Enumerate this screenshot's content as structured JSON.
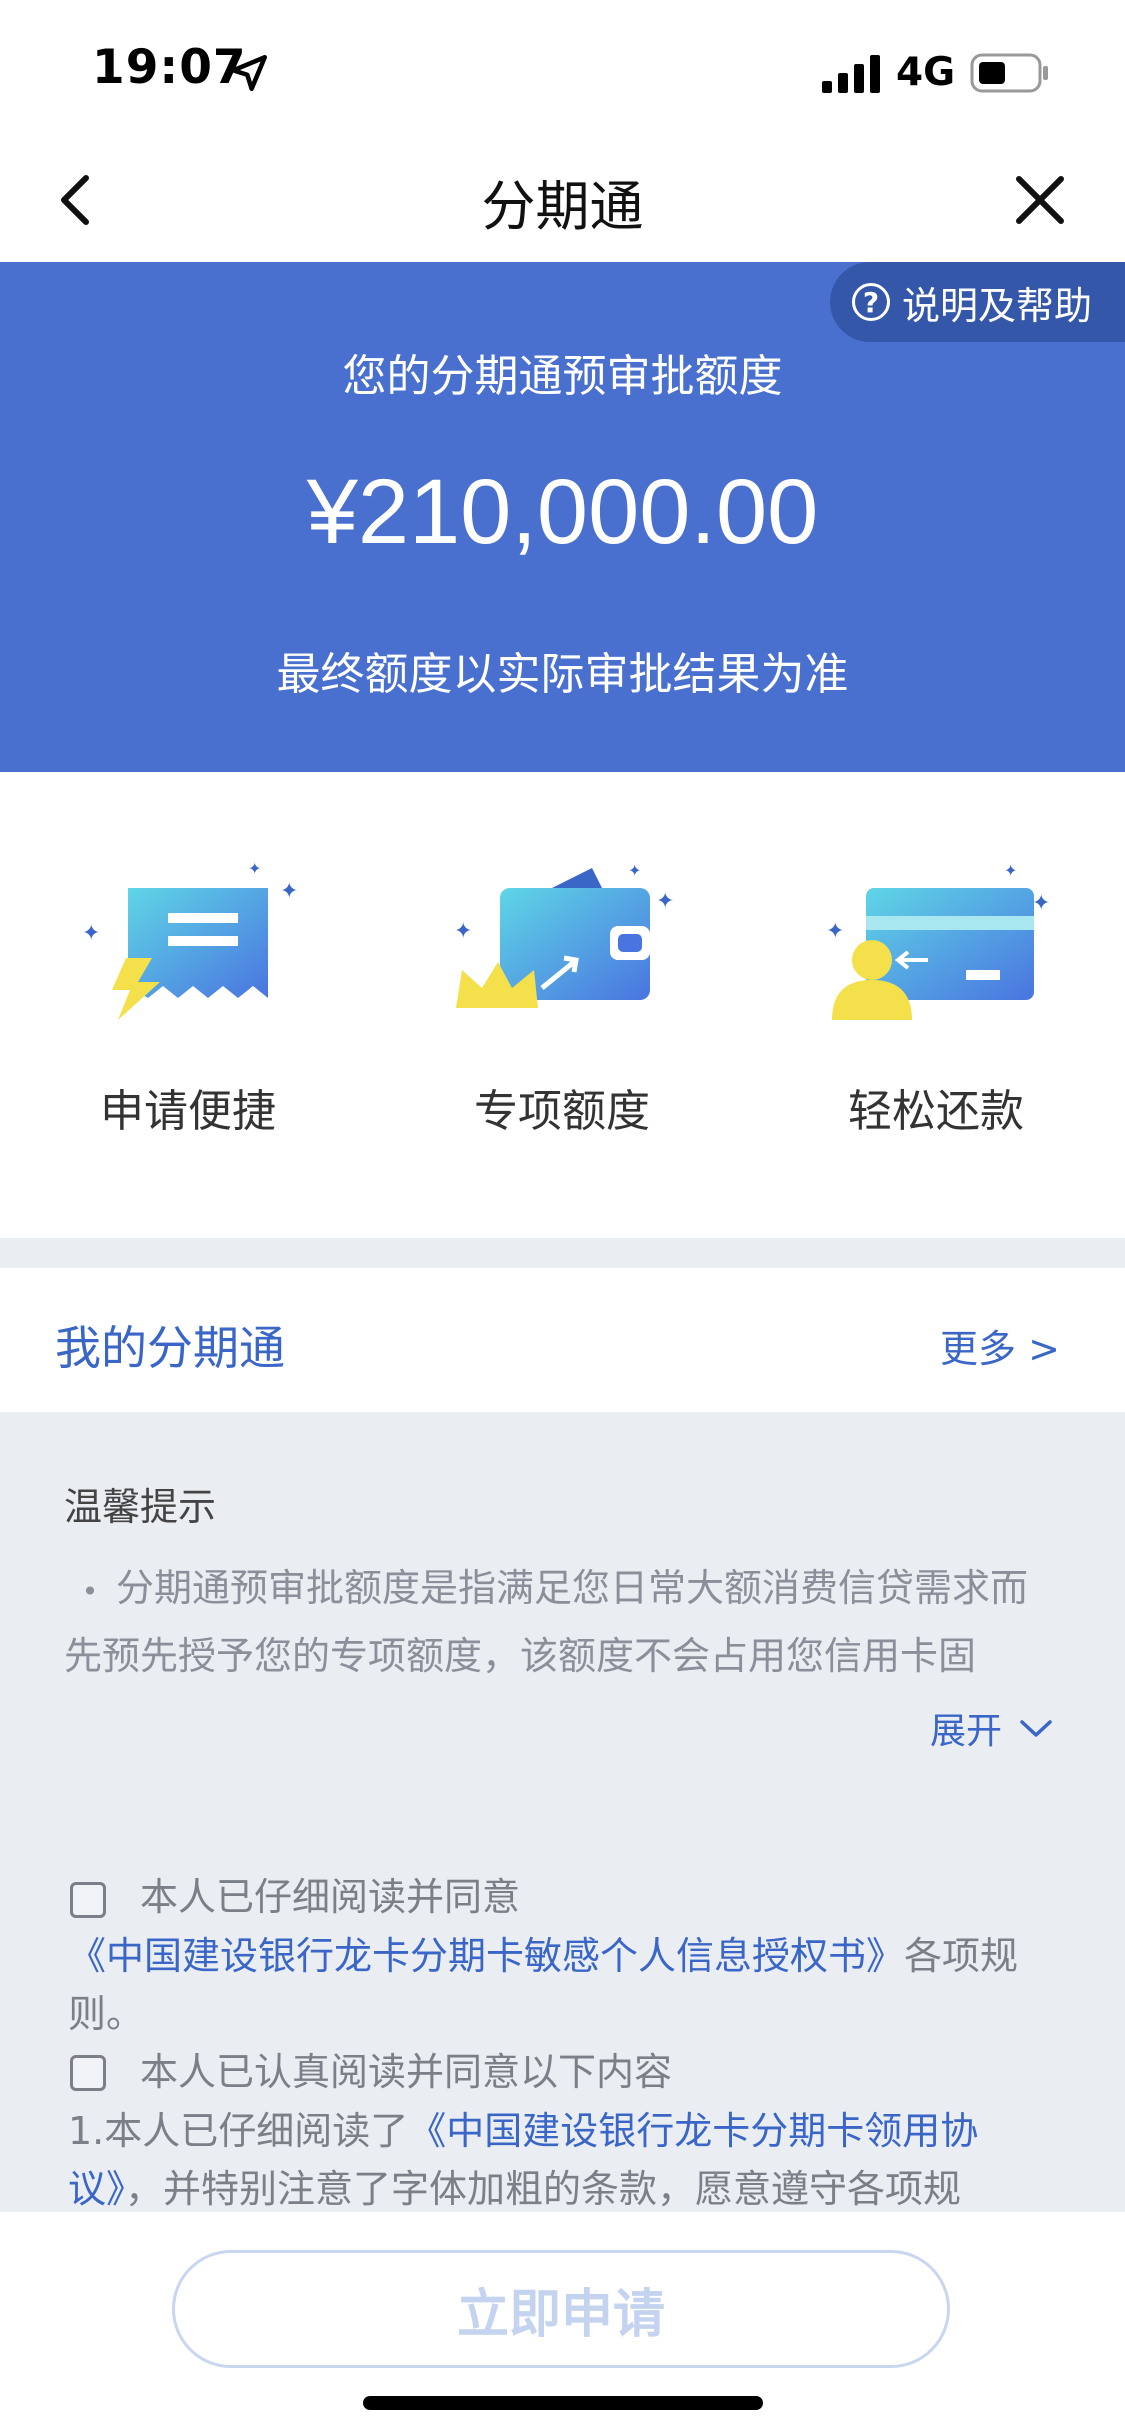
{
  "status_bar": {
    "time": "19:07",
    "network": "4G"
  },
  "nav": {
    "title": "分期通"
  },
  "hero": {
    "help_label": "说明及帮助",
    "label": "您的分期通预审批额度",
    "amount": "¥210,000.00",
    "note": "最终额度以实际审批结果为准"
  },
  "features": [
    {
      "label": "申请便捷",
      "icon": "receipt-lightning-icon"
    },
    {
      "label": "专项额度",
      "icon": "wallet-crown-icon"
    },
    {
      "label": "轻松还款",
      "icon": "card-person-icon"
    }
  ],
  "my_section": {
    "title": "我的分期通",
    "more_label": "更多 >"
  },
  "tips": {
    "title": "温馨提示",
    "bullet": "•",
    "text": "分期通预审批额度是指满足您日常大额消费信贷需求而先预先授予您的专项额度，该额度不会占用您信用卡固",
    "expand_label": "展开"
  },
  "agreements": {
    "first_prefix": "本人已仔细阅读并同意",
    "first_link": "《中国建设银行龙卡分期卡敏感个人信息授权书》",
    "first_suffix": "各项规则。",
    "second_prefix": "本人已认真阅读并同意以下内容",
    "second_line_prefix": "1.本人已仔细阅读了",
    "second_link": "《中国建设银行龙卡分期卡领用协议》",
    "second_suffix": "，并特别注意了字体加粗的条款，愿意遵守各项规"
  },
  "apply_button": {
    "label": "立即申请"
  },
  "colors": {
    "brand_blue": "#4a70cf",
    "help_pill": "#3557a9",
    "link_blue": "#3a66c7",
    "tips_bg": "#eaedf2"
  }
}
